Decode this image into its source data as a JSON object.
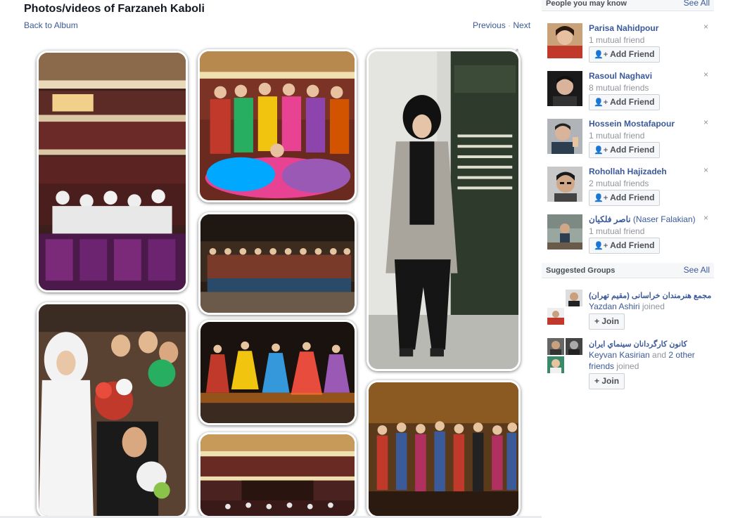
{
  "header": {
    "title": "Photos/videos of Farzaneh Kaboli",
    "back_label": "Back to Album",
    "previous_label": "Previous",
    "separator": "·",
    "next_label": "Next"
  },
  "photos": [
    {
      "scene": "theater-hall-audience"
    },
    {
      "scene": "dance-group-stage-colorful"
    },
    {
      "scene": "woman-portrait-poster"
    },
    {
      "scene": "troupe-lineup-stage"
    },
    {
      "scene": "women-with-bouquets"
    },
    {
      "scene": "folk-dancers-performing"
    },
    {
      "scene": "theater-hall-wide"
    },
    {
      "scene": "costumed-troupe-stage"
    }
  ],
  "people_you_may_know": {
    "title": "People you may know",
    "see_all": "See All",
    "add_friend_label": "Add Friend",
    "close_glyph": "×",
    "people": [
      {
        "name": "Parisa Nahidpour",
        "mutual": "1 mutual friend"
      },
      {
        "name": "Rasoul Naghavi",
        "mutual": "8 mutual friends"
      },
      {
        "name": "Hossein Mostafapour",
        "mutual": "1 mutual friend"
      },
      {
        "name": "Rohollah Hajizadeh",
        "mutual": "2 mutual friends"
      },
      {
        "name": "ناصر فلکیان",
        "name_latin": "(Naser Falakian)",
        "mutual": "1 mutual friend"
      }
    ]
  },
  "suggested_groups": {
    "title": "Suggested Groups",
    "see_all": "See All",
    "join_label": "Join",
    "join_glyph": "+",
    "groups": [
      {
        "name": "مجمع هنرمندان خراسانی (مقیم تهران)",
        "who": "Yazdan Ashiri",
        "joined_text": " joined"
      },
      {
        "name": "كانون كارگردانان سينماي ايران",
        "who": "Keyvan Kasirian",
        "and_text": " and ",
        "others": "2 other friends",
        "joined_text": " joined"
      }
    ]
  },
  "icons": {
    "expand": "expand-icon",
    "add_friend": "add-person-icon",
    "close": "close-icon",
    "join": "plus-icon"
  },
  "colors": {
    "link": "#3b5998",
    "muted": "#90949c",
    "button_bg": "#f6f7f9",
    "button_border": "#ccd0d5"
  }
}
